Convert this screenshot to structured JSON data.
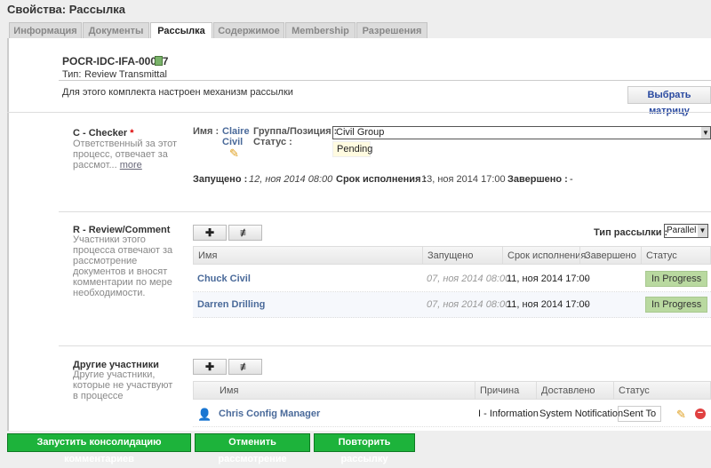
{
  "window": {
    "title": "Свойства: Рассылка"
  },
  "tabs": [
    {
      "label": "Информация"
    },
    {
      "label": "Документы"
    },
    {
      "label": "Рассылка",
      "active": true
    },
    {
      "label": "Содержимое"
    },
    {
      "label": "Membership"
    },
    {
      "label": "Разрешения"
    }
  ],
  "header": {
    "doc_id": "POCR-IDC-IFA-00007",
    "type_label": "Тип:",
    "type_value": "Review Transmittal",
    "notice": "Для этого комплекта настроен механизм рассылки",
    "select_matrix": "Выбрать матрицу"
  },
  "checker": {
    "title": "C - Checker",
    "required": "*",
    "desc": "Ответственный за этот процесс, отвечает за рассмот...",
    "more": "more",
    "name_label": "Имя :",
    "name_line1": "Claire",
    "name_line2": "Civil",
    "group_label": "Группа/Позиция :",
    "status_label": "Статус :",
    "group_value": "Civil Group",
    "status_value": "Pending",
    "started_label": "Запущено :",
    "started_value": "12, ноя 2014 08:00",
    "due_label": "Срок исполнения :",
    "due_value": "13, ноя 2014 17:00",
    "done_label": "Завершено :",
    "done_value": "-"
  },
  "review": {
    "title": "R - Review/Comment",
    "desc": "Участники этого процесса отвечают за рассмотрение документов и вносят комментарии по мере необходимости.",
    "type_label": "Тип рассылки :",
    "type_value": "Parallel",
    "columns": [
      "Имя",
      "Запущено",
      "Срок исполнения",
      "Завершено",
      "Статус"
    ],
    "rows": [
      {
        "name": "Chuck Civil",
        "started": "07, ноя 2014 08:00",
        "due": "11, ноя 2014 17:00",
        "done": "-",
        "status": "In Progress"
      },
      {
        "name": "Darren Drilling",
        "started": "07, ноя 2014 08:00",
        "due": "11, ноя 2014 17:00",
        "done": "-",
        "status": "In Progress"
      }
    ]
  },
  "others": {
    "title": "Другие участники",
    "desc": "Другие участники, которые не участвуют в процессе",
    "columns": [
      "Имя",
      "Причина",
      "Доставлено",
      "Статус"
    ],
    "rows": [
      {
        "name": "Chris Config Manager",
        "reason": "I - Information",
        "delivered": "System Notification",
        "status": "Sent To"
      }
    ]
  },
  "footer": {
    "buttons": [
      "Запустить консолидацию комментариев",
      "Отменить рассмотрение",
      "Повторить рассылку"
    ]
  },
  "colors": {
    "accent_green": "#1db33b",
    "status_green": "#b9d9a0",
    "link": "#4a6a9a"
  }
}
